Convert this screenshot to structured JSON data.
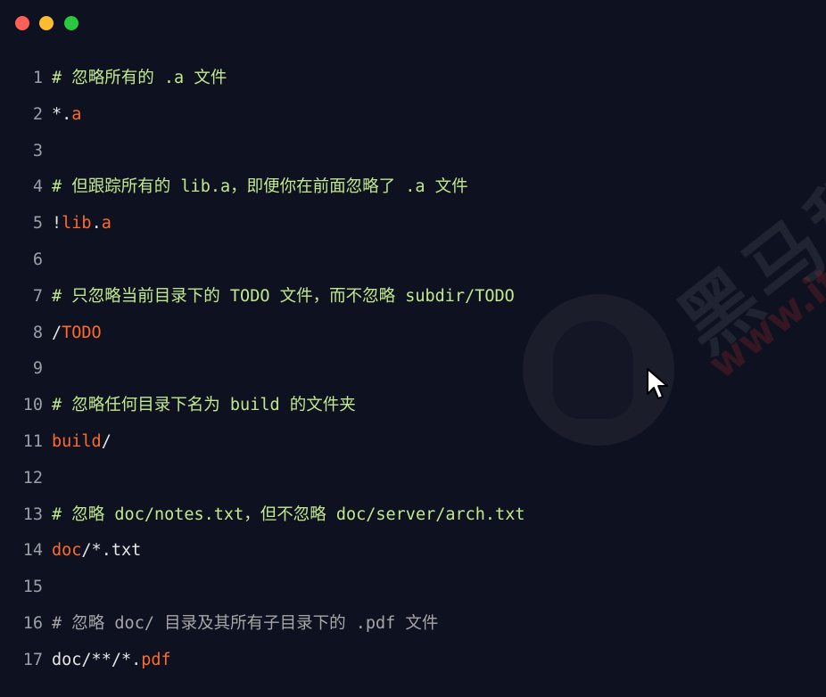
{
  "window": {
    "controls": [
      {
        "name": "close",
        "color": "#ff5f57"
      },
      {
        "name": "minimize",
        "color": "#febc2e"
      },
      {
        "name": "maximize",
        "color": "#28c840"
      }
    ]
  },
  "editor": {
    "colors": {
      "comment": "#c3e88d",
      "comment_dim": "#a6a6a6",
      "operator": "#e6e6e6",
      "name": "#ff6a2b",
      "line_number": "#9aa0a6",
      "background": "#0e1120"
    },
    "lines": [
      {
        "n": "1",
        "comment": "# 忽略所有的 .a 文件"
      },
      {
        "n": "2",
        "parts": [
          {
            "t": "op",
            "v": "*."
          },
          {
            "t": "name",
            "v": "a"
          }
        ]
      },
      {
        "n": "3"
      },
      {
        "n": "4",
        "comment": "# 但跟踪所有的 lib.a，即便你在前面忽略了 .a 文件"
      },
      {
        "n": "5",
        "parts": [
          {
            "t": "op",
            "v": "!"
          },
          {
            "t": "name",
            "v": "lib"
          },
          {
            "t": "op",
            "v": "."
          },
          {
            "t": "name",
            "v": "a"
          }
        ]
      },
      {
        "n": "6"
      },
      {
        "n": "7",
        "comment": "# 只忽略当前目录下的 TODO 文件，而不忽略 subdir/TODO"
      },
      {
        "n": "8",
        "parts": [
          {
            "t": "op",
            "v": "/"
          },
          {
            "t": "name",
            "v": "TODO"
          }
        ]
      },
      {
        "n": "9"
      },
      {
        "n": "10",
        "comment": "# 忽略任何目录下名为 build 的文件夹"
      },
      {
        "n": "11",
        "parts": [
          {
            "t": "name",
            "v": "build"
          },
          {
            "t": "op",
            "v": "/"
          }
        ]
      },
      {
        "n": "12"
      },
      {
        "n": "13",
        "comment": "# 忽略 doc/notes.txt，但不忽略 doc/server/arch.txt"
      },
      {
        "n": "14",
        "parts": [
          {
            "t": "name",
            "v": "doc"
          },
          {
            "t": "op",
            "v": "/*.txt"
          }
        ]
      },
      {
        "n": "15"
      },
      {
        "n": "16",
        "comment": "# 忽略 doc/ 目录及其所有子目录下的 .pdf 文件",
        "dim": true
      },
      {
        "n": "17",
        "parts": [
          {
            "t": "op",
            "v": "doc/**/*."
          },
          {
            "t": "name",
            "v": "pdf"
          }
        ]
      }
    ]
  },
  "watermark": {
    "brand": "黑马程序",
    "url": "www.ithei"
  },
  "cursor": {
    "icon": "mouse-pointer-icon"
  }
}
